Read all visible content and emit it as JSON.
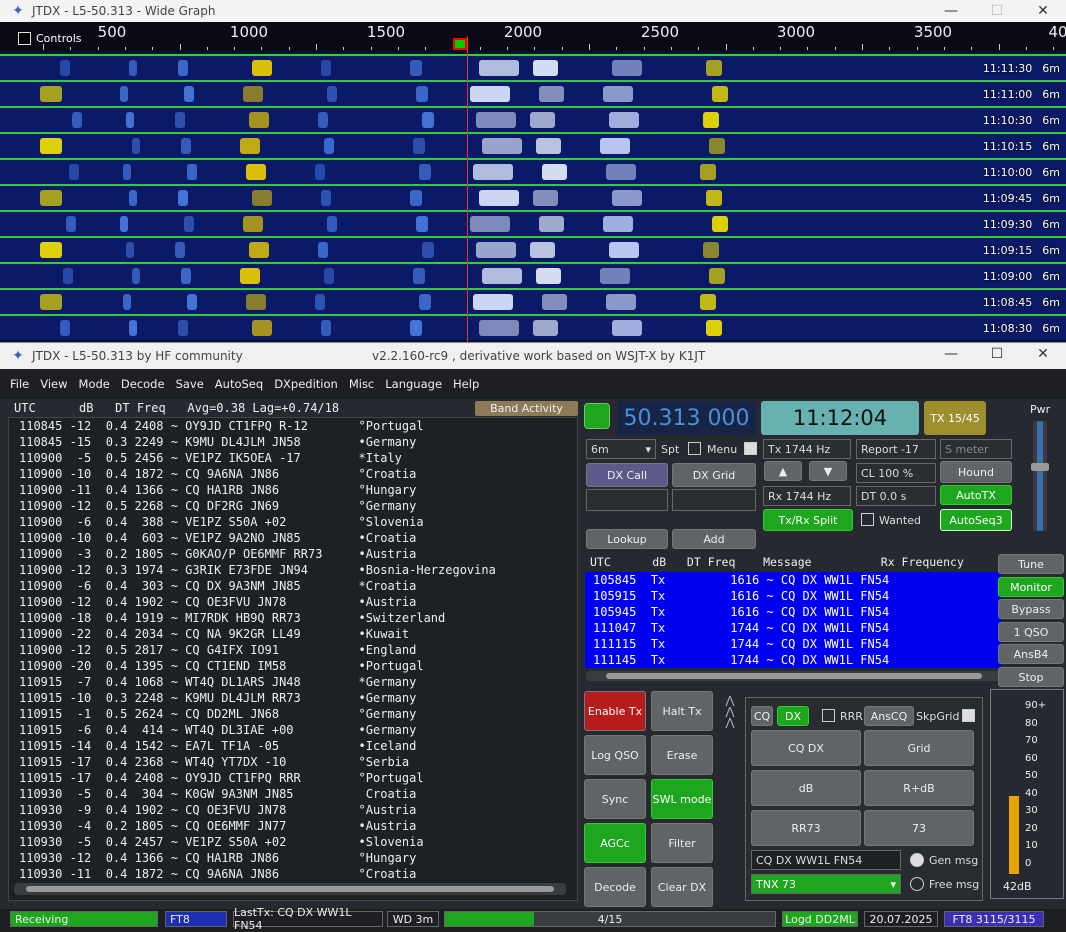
{
  "wide_graph": {
    "title": "JTDX - L5-50.313 - Wide Graph",
    "controls_label": "Controls",
    "scale_labels": [
      "500",
      "1000",
      "1500",
      "2000",
      "2500",
      "3000",
      "3500",
      "40"
    ],
    "strip_times": [
      "11:11:30",
      "11:11:00",
      "11:10:30",
      "11:10:15",
      "11:10:00",
      "11:09:45",
      "11:09:30",
      "11:09:15",
      "11:09:00",
      "11:08:45",
      "11:08:30"
    ],
    "band": "6m"
  },
  "main": {
    "title": "JTDX - L5-50.313   by HF community",
    "title_center": "v2.2.160-rc9 , derivative work based on WSJT-X by K1JT",
    "menu": [
      "File",
      "View",
      "Mode",
      "Decode",
      "Save",
      "AutoSeq",
      "DXpedition",
      "Misc",
      "Language",
      "Help"
    ],
    "band_header": "UTC      dB   DT Freq   Avg=0.38 Lag=+0.74/18",
    "band_activity": "Band Activity",
    "decodes": [
      "110845 -12  0.4 2408 ~ OY9JD CT1FPQ R-12       °Portugal",
      "110845 -15  0.3 2249 ~ K9MU DL4JLM JN58        •Germany",
      "110900  -5  0.5 2456 ~ VE1PZ IK5OEA -17        *Italy",
      "110900 -10  0.4 1872 ~ CQ 9A6NA JN86           °Croatia",
      "110900 -11  0.4 1366 ~ CQ HA1RB JN86           °Hungary",
      "110900 -12  0.5 2268 ~ CQ DF2RG JN69           °Germany",
      "110900  -6  0.4  388 ~ VE1PZ S50A +02          °Slovenia",
      "110900 -10  0.4  603 ~ VE1PZ 9A2NO JN85        •Croatia",
      "110900  -3  0.2 1805 ~ G0KAO/P OE6MMF RR73     •Austria",
      "110900 -12  0.3 1974 ~ G3RIK E73FDE JN94       •Bosnia-Herzegovina",
      "110900  -6  0.4  303 ~ CQ DX 9A3NM JN85        *Croatia",
      "110900 -12  0.4 1902 ~ CQ OE3FVU JN78          •Austria",
      "110900 -18  0.4 1919 ~ MI7RDK HB9Q RR73        •Switzerland",
      "110900 -22  0.4 2034 ~ CQ NA 9K2GR LL49        •Kuwait",
      "110900 -12  0.5 2817 ~ CQ G4IFX IO91           •England",
      "110900 -20  0.4 1395 ~ CQ CT1END IM58          •Portugal",
      "110915  -7  0.4 1068 ~ WT4Q DL1ARS JN48        *Germany",
      "110915 -10  0.3 2248 ~ K9MU DL4JLM RR73        •Germany",
      "110915  -1  0.5 2624 ~ CQ DD2ML JN68           °Germany",
      "110915  -6  0.4  414 ~ WT4Q DL3IAE +00         •Germany",
      "110915 -14  0.4 1542 ~ EA7L TF1A -05           •Iceland",
      "110915 -17  0.4 2368 ~ WT4Q YT7DX -10          °Serbia",
      "110915 -17  0.4 2408 ~ OY9JD CT1FPQ RRR        °Portugal",
      "110930  -5  0.4  304 ~ K0GW 9A3NM JN85          Croatia",
      "110930  -9  0.4 1902 ~ CQ OE3FVU JN78          °Austria",
      "110930  -4  0.2 1805 ~ CQ OE6MMF JN77          •Austria",
      "110930  -5  0.4 2457 ~ VE1PZ S50A +02          •Slovenia",
      "110930 -12  0.4 1366 ~ CQ HA1RB JN86           °Hungary",
      "110930 -11  0.4 1872 ~ CQ 9A6NA JN86           °Croatia"
    ],
    "frequency": "50.313 000",
    "clock": "11:12:04",
    "tx_period": "TX 15/45",
    "pwr_label": "Pwr",
    "band_select": "6m",
    "spt_label": "Spt",
    "menu_label": "Menu",
    "tx_hz": "Tx  1744  Hz",
    "rx_hz": "Rx  1744  Hz",
    "report": "Report -17",
    "s_meter": "S meter",
    "cl": "CL  100 %",
    "dt": "DT 0.0 s",
    "hound": "Hound",
    "autotx": "AutoTX",
    "autoseq3": "AutoSeq3",
    "wanted": "Wanted",
    "txrx_split": "Tx/Rx Split",
    "dx_call": "DX Call",
    "dx_grid": "DX Grid",
    "lookup": "Lookup",
    "add": "Add",
    "up_arrow": "▲",
    "down_arrow": "▼",
    "tx_header": "UTC      dB   DT Freq    Message          Rx Frequency",
    "tx_rows": [
      "105845  Tx         1616 ~ CQ DX WW1L FN54",
      "105915  Tx         1616 ~ CQ DX WW1L FN54",
      "105945  Tx         1616 ~ CQ DX WW1L FN54",
      "111047  Tx         1744 ~ CQ DX WW1L FN54",
      "111115  Tx         1744 ~ CQ DX WW1L FN54",
      "111145  Tx         1744 ~ CQ DX WW1L FN54"
    ],
    "side_buttons": [
      "Tune",
      "Monitor",
      "Bypass",
      "1 QSO",
      "AnsB4",
      "Stop"
    ],
    "left_buttons": {
      "enable_tx": "Enable Tx",
      "halt_tx": "Halt Tx",
      "log_qso": "Log QSO",
      "erase": "Erase",
      "sync": "Sync",
      "swl": "SWL mode",
      "agcc": "AGCc",
      "filter": "Filter",
      "decode": "Decode",
      "clear_dx": "Clear DX"
    },
    "gen": {
      "cq": "CQ",
      "dx": "DX",
      "rrr": "RRR",
      "anscq": "AnsCQ",
      "skpgrid": "SkpGrid",
      "cqdx": "CQ DX",
      "grid": "Grid",
      "db": "dB",
      "rdb": "R+dB",
      "rr73": "RR73",
      "n73": "73",
      "msg_value": "CQ DX WW1L FN54",
      "tnx": "TNX 73",
      "gen_msg": "Gen msg",
      "free_msg": "Free msg"
    },
    "meter": {
      "ticks": [
        "90+",
        "80",
        "70",
        "60",
        "50",
        "40",
        "30",
        "20",
        "10",
        "0"
      ],
      "db": "42dB",
      "level": 42
    },
    "status": {
      "receiving": "Receiving",
      "mode": "FT8",
      "lasttx": "LastTx: CQ DX WW1L FN54",
      "wd": "WD 3m",
      "progress_text": "4/15",
      "progress": 0.27,
      "logd": "Logd DD2ML",
      "date": "20.07.2025",
      "ft8count": "FT8  3115/3115"
    },
    "colors": {
      "accent_green": "#1fa61f",
      "tx_blue": "#0000f0",
      "clock_teal": "#68b1b1"
    }
  }
}
